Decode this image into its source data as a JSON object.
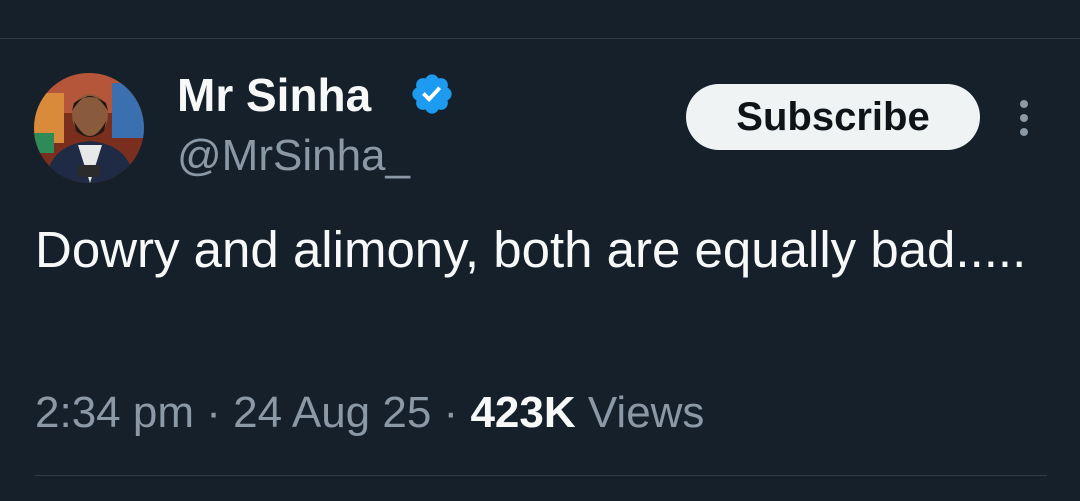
{
  "tweet": {
    "author": {
      "display_name": "Mr Sinha",
      "handle": "@MrSinha_",
      "verified": true,
      "verified_color": "#1d9bf0",
      "avatar_icon": "profile-photo"
    },
    "subscribe_label": "Subscribe",
    "more_icon": "more-vertical-icon",
    "text": "Dowry and alimony, both are equally bad.....",
    "time": "2:34 pm",
    "separator": "·",
    "date": "24 Aug 25",
    "views_count": "423K",
    "views_label": "Views"
  },
  "colors": {
    "background": "#15202b",
    "primary_text": "#f7f9f9",
    "secondary_text": "#8b98a5",
    "button_bg": "#eff3f4"
  }
}
